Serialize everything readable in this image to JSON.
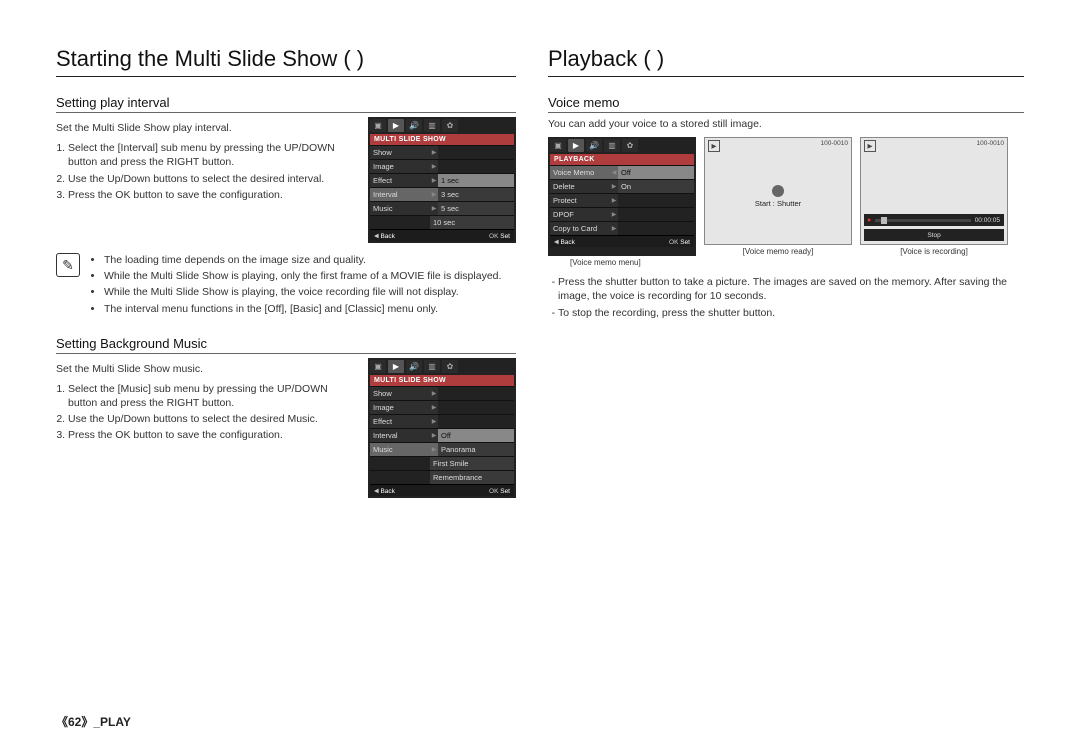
{
  "left": {
    "title": "Starting the Multi Slide Show   (        )",
    "interval": {
      "heading": "Setting play interval",
      "desc": "Set the Multi Slide Show play interval.",
      "steps": [
        "Select the [Interval] sub menu by pressing the UP/DOWN button and press the RIGHT button.",
        "Use the Up/Down buttons to select the desired interval.",
        "Press the OK button to save the configuration."
      ],
      "lcd": {
        "title": "MULTI SLIDE SHOW",
        "rows": [
          "Show",
          "Image",
          "Effect",
          "Interval",
          "Music"
        ],
        "hi": "Interval",
        "opts": [
          "1 sec",
          "3 sec",
          "5 sec",
          "10 sec"
        ],
        "sel": "1 sec",
        "footer_back": "Back",
        "footer_set": "Set"
      }
    },
    "note_lines": [
      "The loading time depends on the image size and quality.",
      "While the Multi Slide Show is playing, only the first frame of a MOVIE file is displayed.",
      "While the Multi Slide Show is playing, the voice recording file will not display.",
      "The interval menu functions in the [Off], [Basic] and [Classic] menu only."
    ],
    "music": {
      "heading": "Setting Background Music",
      "desc": "Set the Multi Slide Show music.",
      "steps": [
        "Select the [Music] sub menu by pressing the UP/DOWN button and press the RIGHT button.",
        "Use the Up/Down buttons to select the desired Music.",
        "Press the OK button to save the configuration."
      ],
      "lcd": {
        "title": "MULTI SLIDE SHOW",
        "rows": [
          "Show",
          "Image",
          "Effect",
          "Interval",
          "Music"
        ],
        "hi": "Music",
        "opts": [
          "Off",
          "Panorama",
          "First Smile",
          "Remembrance"
        ],
        "sel": "Off",
        "footer_back": "Back",
        "footer_set": "Set"
      }
    }
  },
  "right": {
    "title": "Playback (        )",
    "memo": {
      "heading": "Voice memo",
      "desc": "You can add your voice to a stored still image.",
      "lcd": {
        "title": "PLAYBACK",
        "rows": [
          "Voice Memo",
          "Delete",
          "Protect",
          "DPOF",
          "Copy to Card"
        ],
        "hi": "Voice Memo",
        "opts": [
          "Off",
          "On"
        ],
        "sel": "Off",
        "footer_back": "Back",
        "footer_set": "Set"
      },
      "shot1": {
        "meta": "100-0010",
        "caption": "Start : Shutter",
        "label": "[Voice memo menu]"
      },
      "shot2": {
        "meta": "100-0010",
        "time": "00:00:05",
        "btn": "Stop",
        "label": "[Voice memo ready]"
      },
      "rec_label": "[Voice is recording]",
      "bullets": [
        "Press the shutter button to take a picture. The images are saved on the memory. After saving the image, the voice is recording for 10 seconds.",
        "To stop the recording, press the shutter button."
      ]
    }
  },
  "footer": "《62》_PLAY"
}
